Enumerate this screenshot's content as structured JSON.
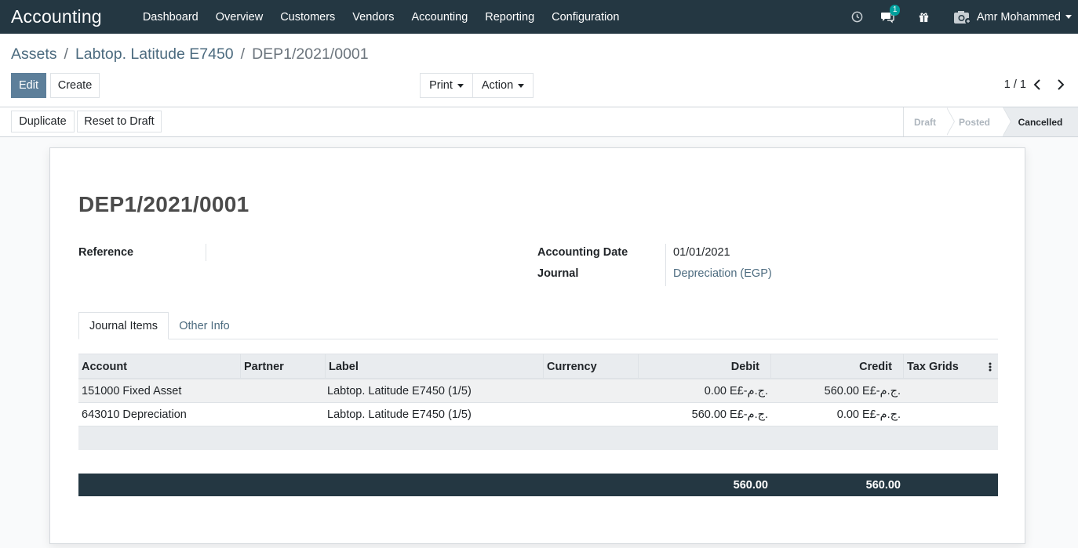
{
  "navbar": {
    "brand": "Accounting",
    "menu": [
      "Dashboard",
      "Overview",
      "Customers",
      "Vendors",
      "Accounting",
      "Reporting",
      "Configuration"
    ],
    "messages_count": "1",
    "user_name": "Amr Mohammed"
  },
  "breadcrumb": {
    "items": [
      "Assets",
      "Labtop. Latitude E7450"
    ],
    "current": "DEP1/2021/0001"
  },
  "toolbar": {
    "edit_label": "Edit",
    "create_label": "Create",
    "print_label": "Print",
    "action_label": "Action",
    "pager": "1 / 1"
  },
  "status_actions": {
    "duplicate_label": "Duplicate",
    "reset_label": "Reset to Draft"
  },
  "stages": [
    "Draft",
    "Posted",
    "Cancelled"
  ],
  "form": {
    "title": "DEP1/2021/0001",
    "reference_label": "Reference",
    "reference_value": "",
    "accounting_date_label": "Accounting Date",
    "accounting_date_value": "01/01/2021",
    "journal_label": "Journal",
    "journal_value": "Depreciation (EGP)"
  },
  "tabs": [
    "Journal Items",
    "Other Info"
  ],
  "table": {
    "columns": [
      "Account",
      "Partner",
      "Label",
      "Currency",
      "Debit",
      "Credit",
      "Tax Grids"
    ],
    "rows": [
      {
        "account": "151000 Fixed Asset",
        "partner": "",
        "label": "Labtop. Latitude E7450 (1/5)",
        "currency": "",
        "debit": "0.00 E£-ج.م.",
        "credit": "560.00 E£-ج.م.",
        "tax": ""
      },
      {
        "account": "643010 Depreciation",
        "partner": "",
        "label": "Labtop. Latitude E7450 (1/5)",
        "currency": "",
        "debit": "560.00 E£-ج.م.",
        "credit": "0.00 E£-ج.م.",
        "tax": ""
      }
    ],
    "total_debit": "560.00",
    "total_credit": "560.00"
  }
}
